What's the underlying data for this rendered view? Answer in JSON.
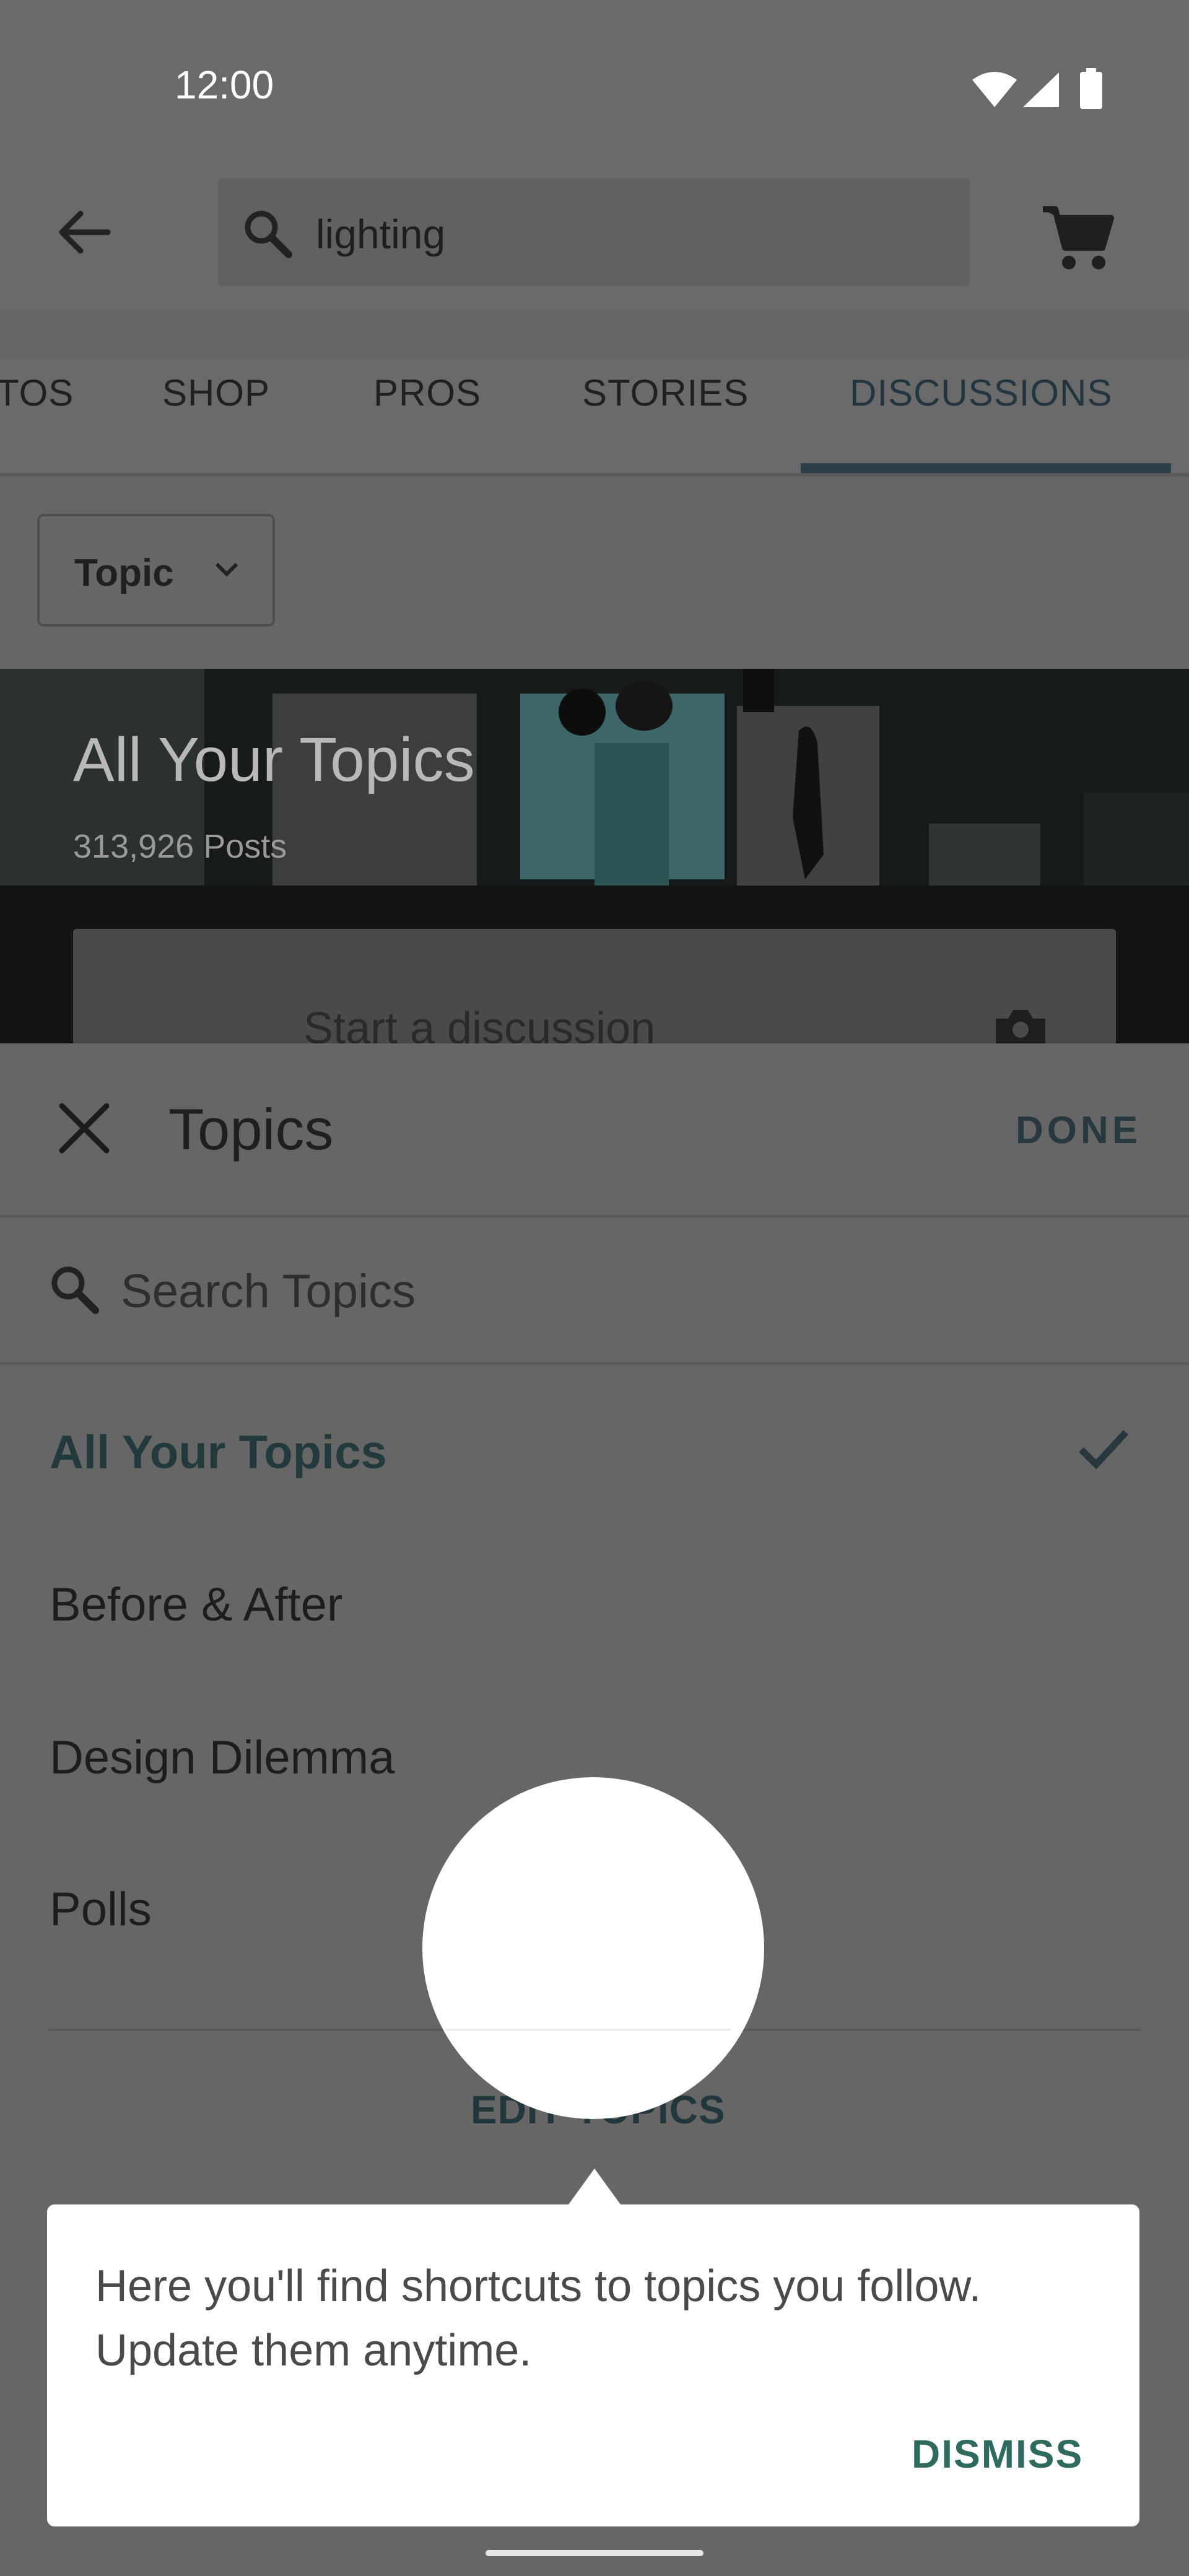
{
  "status_bar": {
    "time": "12:00"
  },
  "search": {
    "query": "lighting"
  },
  "tabs": [
    {
      "label": "TOS"
    },
    {
      "label": "SHOP"
    },
    {
      "label": "PROS"
    },
    {
      "label": "STORIES"
    },
    {
      "label": "DISCUSSIONS",
      "selected": true
    }
  ],
  "filter": {
    "label": "Topic"
  },
  "hero": {
    "title": "All Your Topics",
    "subtitle": "313,926 Posts",
    "start_discussion": "Start a discussion"
  },
  "sheet": {
    "title": "Topics",
    "done_label": "DONE",
    "search_placeholder": "Search Topics",
    "topics": [
      {
        "label": "All Your Topics",
        "selected": true
      },
      {
        "label": "Before & After"
      },
      {
        "label": "Design Dilemma"
      },
      {
        "label": "Polls"
      }
    ],
    "edit_label": "EDIT TOPICS"
  },
  "tooltip": {
    "message": "Here you'll find shortcuts to topics you follow. Update them anytime.",
    "dismiss_label": "DISMISS"
  },
  "colors": {
    "scrim": "#666666",
    "accent_dark": "#23363f",
    "accent_green": "#2e6b5e",
    "surface": "#ffffff"
  },
  "icons": [
    "wifi-icon",
    "signal-icon",
    "battery-icon",
    "back-arrow-icon",
    "search-icon",
    "cart-icon",
    "chevron-down-icon",
    "camera-icon",
    "close-icon",
    "checkmark-icon"
  ]
}
